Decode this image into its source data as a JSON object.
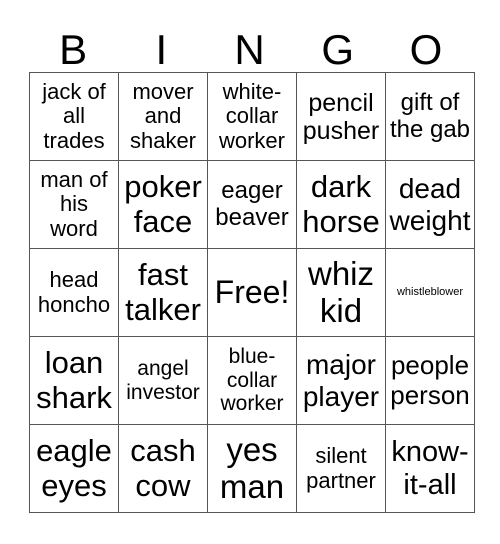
{
  "header": [
    "B",
    "I",
    "N",
    "G",
    "O"
  ],
  "grid": [
    [
      "jack of\nall\ntrades",
      "mover\nand\nshaker",
      "white-\ncollar\nworker",
      "pencil\npusher",
      "gift of\nthe gab"
    ],
    [
      "man of\nhis\nword",
      "poker\nface",
      "eager\nbeaver",
      "dark\nhorse",
      "dead\nweight"
    ],
    [
      "head\nhoncho",
      "fast\ntalker",
      "Free!",
      "whiz\nkid",
      "whistleblower"
    ],
    [
      "loan\nshark",
      "angel\ninvestor",
      "blue-\ncollar\nworker",
      "major\nplayer",
      "people\nperson"
    ],
    [
      "eagle\neyes",
      "cash\ncow",
      "yes\nman",
      "silent\npartner",
      "know-\nit-all"
    ]
  ]
}
